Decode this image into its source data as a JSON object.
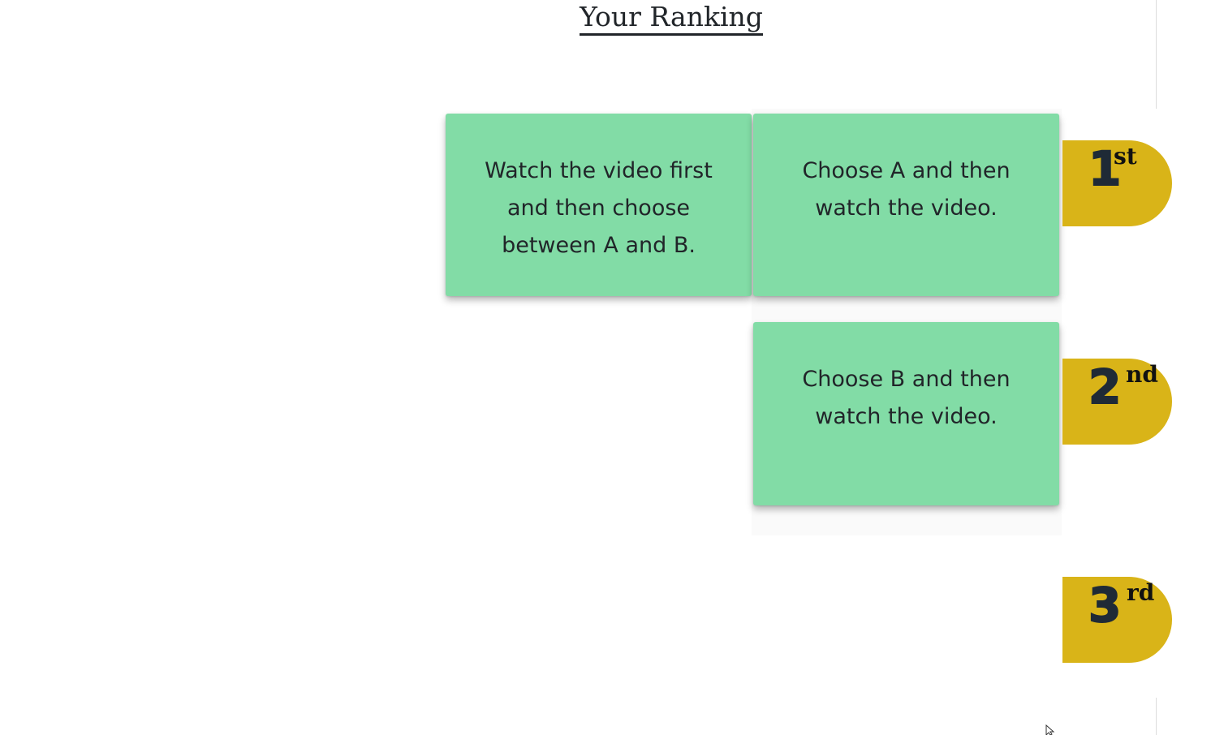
{
  "heading": {
    "title": "Your Ranking"
  },
  "cards": [
    {
      "id": "card-watch-first",
      "text": "Watch the video first and then choose between A and B."
    },
    {
      "id": "card-choose-a",
      "text": "Choose A and then watch the video."
    },
    {
      "id": "card-choose-b",
      "text": "Choose B and then watch the video."
    }
  ],
  "ranks": [
    {
      "number": "1",
      "suffix": "st"
    },
    {
      "number": "2",
      "suffix": "nd"
    },
    {
      "number": "3",
      "suffix": "rd"
    }
  ],
  "colors": {
    "card": "#82dca6",
    "badge": "#d9b418",
    "text": "#212529"
  },
  "icons": {
    "cursor": "mouse-pointer-icon"
  }
}
